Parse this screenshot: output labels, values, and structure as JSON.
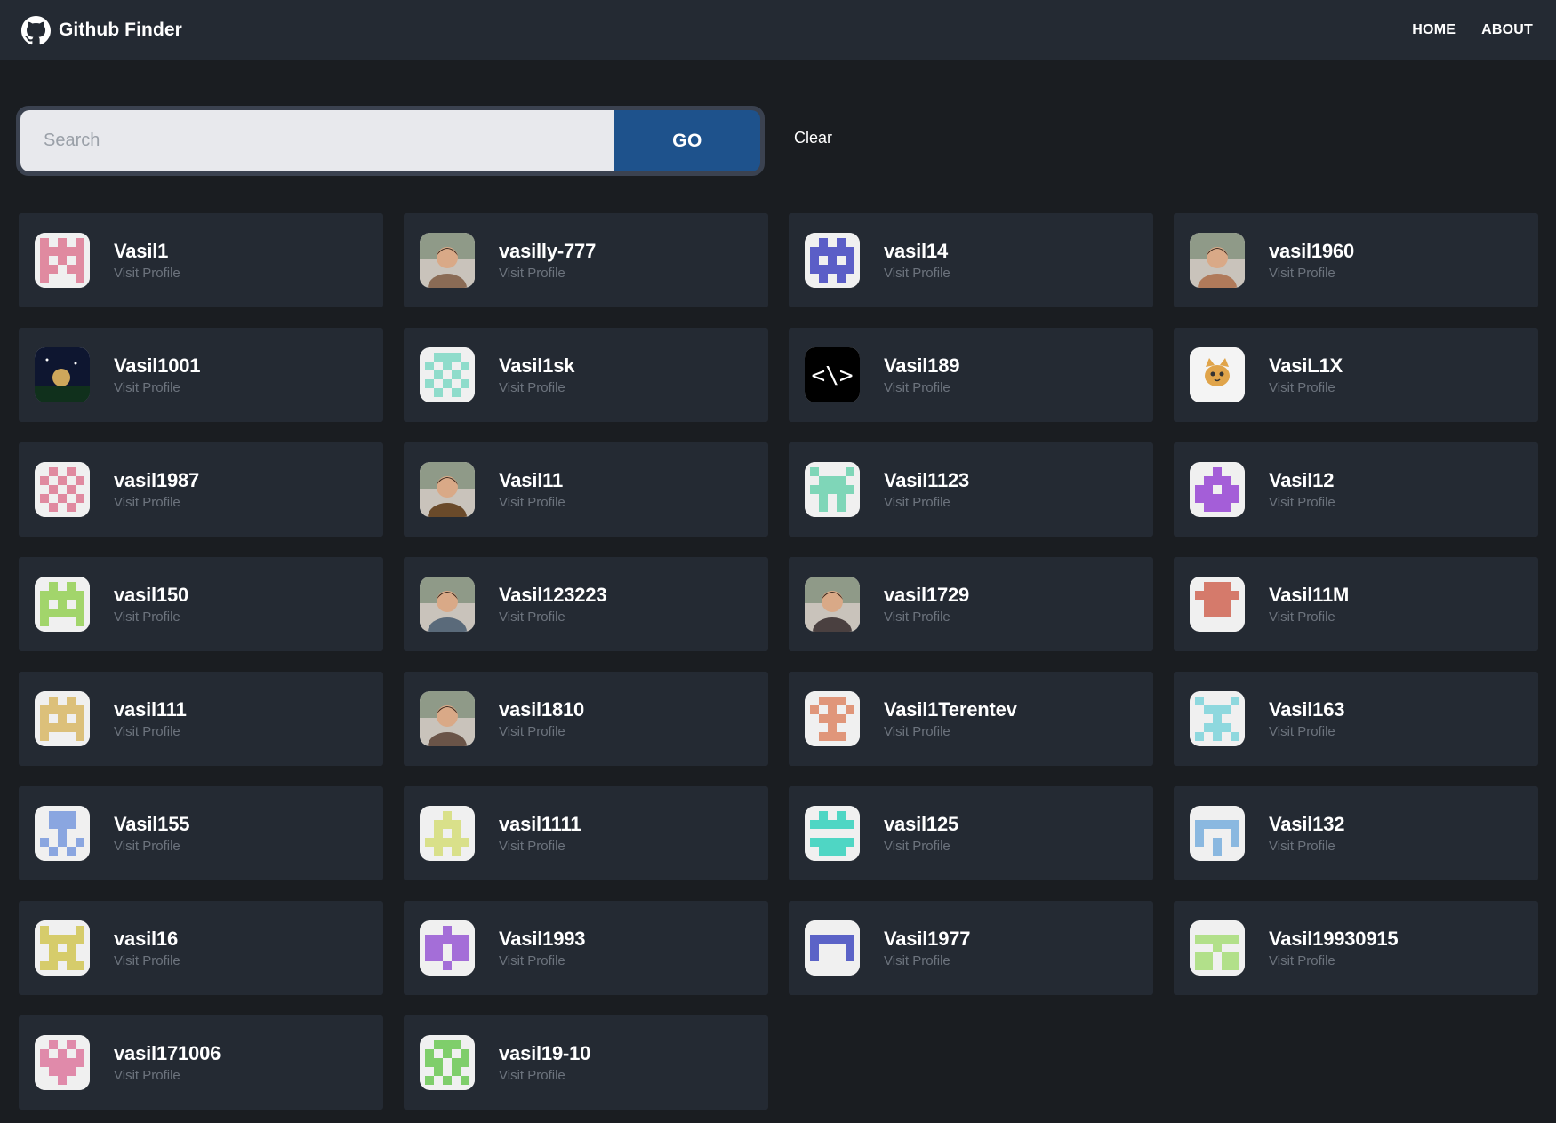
{
  "app": {
    "title": "Github Finder",
    "nav": [
      {
        "label": "HOME",
        "key": "home"
      },
      {
        "label": "ABOUT",
        "key": "about"
      }
    ]
  },
  "search": {
    "placeholder": "Search",
    "value": "",
    "go_label": "GO",
    "clear_label": "Clear"
  },
  "visit_label": "Visit Profile",
  "users": [
    {
      "login": "Vasil1",
      "avatar": "identicon",
      "color": "#e08aa0",
      "pattern": "h"
    },
    {
      "login": "vasilly-777",
      "avatar": "photo",
      "color": "#8a6b55",
      "pattern": "photo"
    },
    {
      "login": "vasil14",
      "avatar": "identicon",
      "color": "#5b5ec7",
      "pattern": "bars"
    },
    {
      "login": "vasil1960",
      "avatar": "photo",
      "color": "#b07a5a",
      "pattern": "photo"
    },
    {
      "login": "Vasil1001",
      "avatar": "photo",
      "color": "#1b2a4a",
      "pattern": "night"
    },
    {
      "login": "Vasil1sk",
      "avatar": "identicon",
      "color": "#8fdccb",
      "pattern": "cross"
    },
    {
      "login": "Vasil189",
      "avatar": "code-icon",
      "color": "#000000",
      "pattern": "code"
    },
    {
      "login": "VasiL1X",
      "avatar": "cat-icon",
      "color": "#e0a44a",
      "pattern": "cat"
    },
    {
      "login": "vasil1987",
      "avatar": "identicon",
      "color": "#e08aa0",
      "pattern": "checker"
    },
    {
      "login": "Vasil11",
      "avatar": "photo",
      "color": "#6a4a2a",
      "pattern": "photo"
    },
    {
      "login": "Vasil1123",
      "avatar": "identicon",
      "color": "#7fd6b8",
      "pattern": "x"
    },
    {
      "login": "Vasil12",
      "avatar": "identicon",
      "color": "#a45ed8",
      "pattern": "robot"
    },
    {
      "login": "vasil150",
      "avatar": "identicon",
      "color": "#a2d56b",
      "pattern": "invader"
    },
    {
      "login": "Vasil123223",
      "avatar": "photo",
      "color": "#5a6a7a",
      "pattern": "photo"
    },
    {
      "login": "vasil1729",
      "avatar": "photo",
      "color": "#4a4040",
      "pattern": "photo"
    },
    {
      "login": "Vasil11M",
      "avatar": "identicon",
      "color": "#d57a6b",
      "pattern": "block"
    },
    {
      "login": "vasil111",
      "avatar": "identicon",
      "color": "#dcc07a",
      "pattern": "frame"
    },
    {
      "login": "vasil1810",
      "avatar": "photo",
      "color": "#6a5448",
      "pattern": "photo"
    },
    {
      "login": "Vasil1Terentev",
      "avatar": "identicon",
      "color": "#e0967a",
      "pattern": "t"
    },
    {
      "login": "Vasil163",
      "avatar": "identicon",
      "color": "#8ed8de",
      "pattern": "xshape"
    },
    {
      "login": "Vasil155",
      "avatar": "identicon",
      "color": "#8aa6e0",
      "pattern": "tee"
    },
    {
      "login": "vasil1111",
      "avatar": "identicon",
      "color": "#d9e08a",
      "pattern": "house"
    },
    {
      "login": "vasil125",
      "avatar": "identicon",
      "color": "#4fd6c4",
      "pattern": "cup"
    },
    {
      "login": "Vasil132",
      "avatar": "identicon",
      "color": "#8ab8e0",
      "pattern": "arch"
    },
    {
      "login": "vasil16",
      "avatar": "identicon",
      "color": "#d6cc6b",
      "pattern": "h2"
    },
    {
      "login": "Vasil1993",
      "avatar": "identicon",
      "color": "#a46ed8",
      "pattern": "blob"
    },
    {
      "login": "Vasil1977",
      "avatar": "identicon",
      "color": "#5b63c7",
      "pattern": "gate"
    },
    {
      "login": "Vasil19930915",
      "avatar": "identicon",
      "color": "#b2e08a",
      "pattern": "tee2"
    },
    {
      "login": "vasil171006",
      "avatar": "identicon",
      "color": "#e08aaa",
      "pattern": "face"
    },
    {
      "login": "vasil19-10",
      "avatar": "identicon",
      "color": "#7fce6b",
      "pattern": "dots"
    }
  ]
}
